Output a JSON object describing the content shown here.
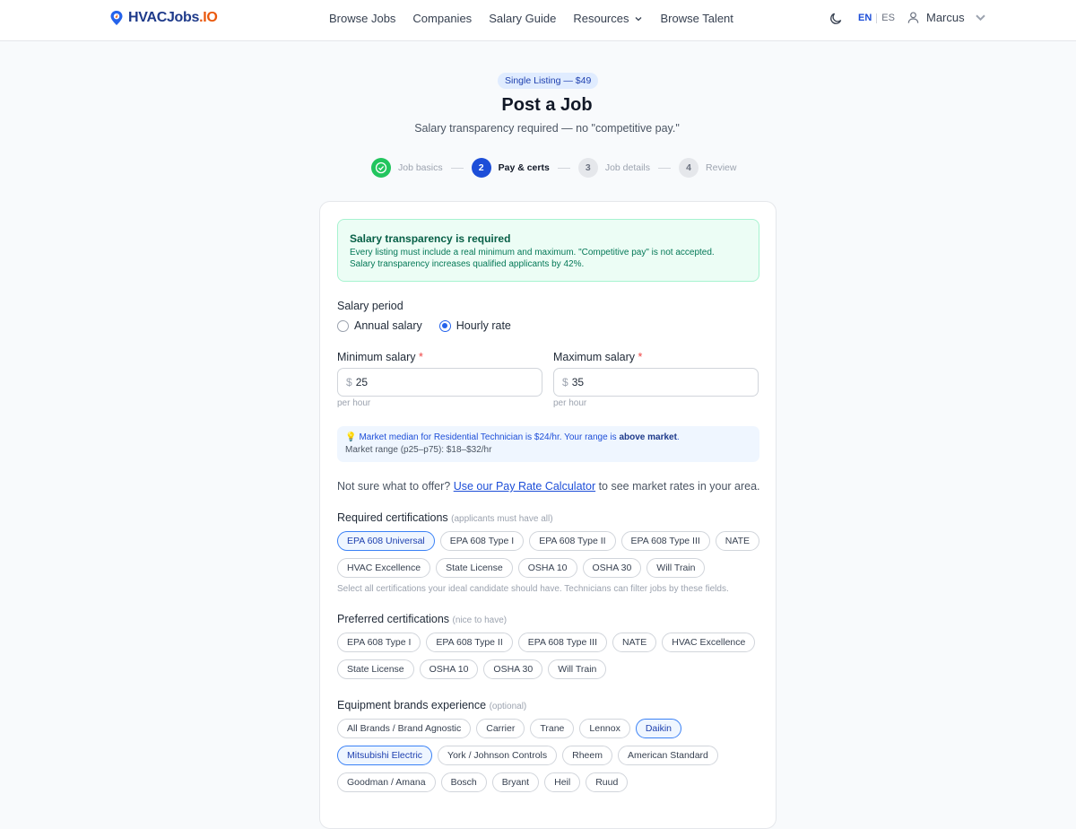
{
  "nav": {
    "logo_a": "HVACJobs",
    "logo_b": ".IO",
    "links": [
      "Browse Jobs",
      "Companies",
      "Salary Guide",
      "Resources",
      "Browse Talent"
    ],
    "lang_en": "EN",
    "lang_es": "ES",
    "user": "Marcus"
  },
  "header": {
    "badge": "Single Listing — $49",
    "title": "Post a Job",
    "subtitle": "Salary transparency required — no \"competitive pay.\""
  },
  "steps": [
    {
      "num": "",
      "label": "Job basics",
      "state": "done"
    },
    {
      "num": "2",
      "label": "Pay & certs",
      "state": "active"
    },
    {
      "num": "3",
      "label": "Job details",
      "state": "todo"
    },
    {
      "num": "4",
      "label": "Review",
      "state": "todo"
    }
  ],
  "alert": {
    "title": "Salary transparency is required",
    "line1": "Every listing must include a real minimum and maximum. \"Competitive pay\" is not accepted.",
    "line2": "Salary transparency increases qualified applicants by 42%."
  },
  "salary": {
    "period_label": "Salary period",
    "annual_label": "Annual salary",
    "hourly_label": "Hourly rate",
    "selected": "hourly",
    "min_label": "Minimum salary",
    "max_label": "Maximum salary",
    "required_mark": "*",
    "currency": "$",
    "min_value": "25",
    "max_value": "35",
    "unit_hint": "per hour"
  },
  "market": {
    "prefix": "Market median for Residential Technician is $24/hr. Your range is ",
    "emphasis": "above market",
    "suffix": ".",
    "range": "Market range (p25–p75): $18–$32/hr"
  },
  "calc": {
    "prefix": "Not sure what to offer? ",
    "link": "Use our Pay Rate Calculator",
    "suffix": " to see market rates in your area."
  },
  "required_certs": {
    "title": "Required certifications",
    "note": "(applicants must have all)",
    "items": [
      "EPA 608 Universal",
      "EPA 608 Type I",
      "EPA 608 Type II",
      "EPA 608 Type III",
      "NATE",
      "HVAC Excellence",
      "State License",
      "OSHA 10",
      "OSHA 30",
      "Will Train"
    ],
    "selected": [
      "EPA 608 Universal"
    ],
    "hint": "Select all certifications your ideal candidate should have. Technicians can filter jobs by these fields."
  },
  "preferred_certs": {
    "title": "Preferred certifications",
    "note": "(nice to have)",
    "items": [
      "EPA 608 Type I",
      "EPA 608 Type II",
      "EPA 608 Type III",
      "NATE",
      "HVAC Excellence",
      "State License",
      "OSHA 10",
      "OSHA 30",
      "Will Train"
    ],
    "selected": []
  },
  "brands": {
    "title": "Equipment brands experience",
    "note": "(optional)",
    "items": [
      "All Brands / Brand Agnostic",
      "Carrier",
      "Trane",
      "Lennox",
      "Daikin",
      "Mitsubishi Electric",
      "York / Johnson Controls",
      "Rheem",
      "American Standard",
      "Goodman / Amana",
      "Bosch",
      "Bryant",
      "Heil",
      "Ruud"
    ],
    "selected": [
      "Daikin",
      "Mitsubishi Electric"
    ]
  }
}
